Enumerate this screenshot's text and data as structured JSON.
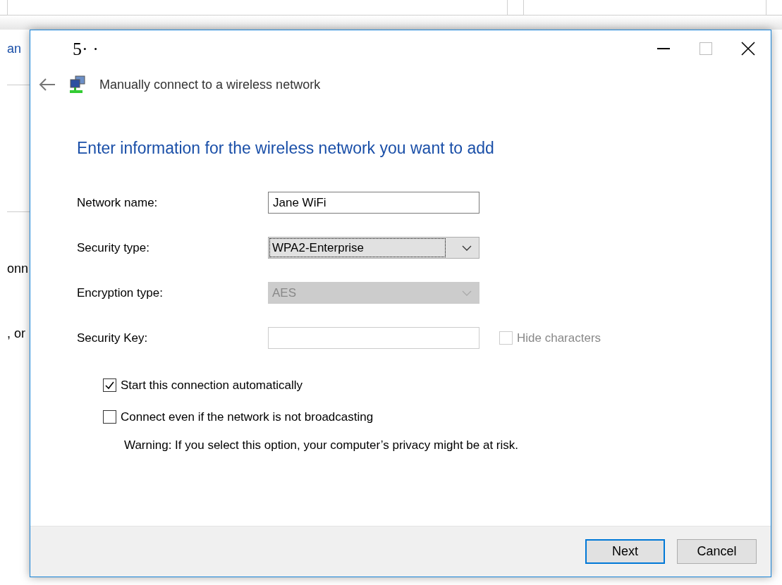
{
  "background": {
    "fragments": [
      {
        "text": "an",
        "kind": "link"
      },
      {
        "text": "onn",
        "kind": "text"
      },
      {
        "text": ", or",
        "kind": "text"
      }
    ]
  },
  "window": {
    "title": "5· ·"
  },
  "header": {
    "title": "Manually connect to a wireless network"
  },
  "heading": "Enter information for the wireless network you want to add",
  "fields": [
    {
      "kind": "text",
      "label": "Network name:",
      "value": "Jane WiFi",
      "disabled": false
    },
    {
      "kind": "select",
      "label": "Security type:",
      "value": "WPA2-Enterprise",
      "disabled": false,
      "focused": true
    },
    {
      "kind": "select",
      "label": "Encryption type:",
      "value": "AES",
      "disabled": true,
      "focused": false
    },
    {
      "kind": "text",
      "label": "Security Key:",
      "disabled": true,
      "option": {
        "label": "Hide characters",
        "checked": false,
        "disabled": true
      }
    }
  ],
  "options": [
    {
      "label": "Start this connection automatically",
      "checked": true
    },
    {
      "label": "Connect even if the network is not broadcasting",
      "checked": false,
      "note": "Warning: If you select this option, your computer’s privacy might be at risk."
    }
  ],
  "buttons": [
    {
      "label": "Next",
      "default": true
    },
    {
      "label": "Cancel",
      "default": false
    }
  ]
}
